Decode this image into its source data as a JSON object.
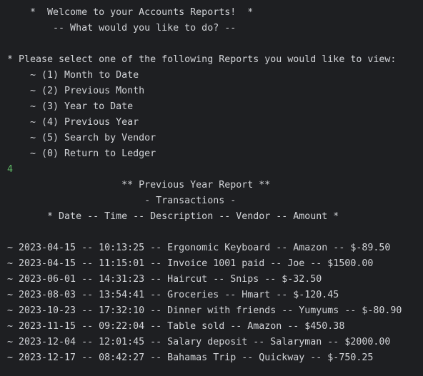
{
  "terminal": {
    "lines": [
      "    *  Welcome to your Accounts Reports!  *",
      "        -- What would you like to do? --",
      "",
      "* Please select one of the following Reports you would like to view:",
      "    ~ (1) Month to Date",
      "    ~ (2) Previous Month",
      "    ~ (3) Year to Date",
      "    ~ (4) Previous Year",
      "    ~ (5) Search by Vendor",
      "    ~ (0) Return to Ledger",
      "4",
      "                    ** Previous Year Report **",
      "                        - Transactions -",
      "       * Date -- Time -- Description -- Vendor -- Amount *",
      "",
      "~ 2023-04-15 -- 10:13:25 -- Ergonomic Keyboard -- Amazon -- $-89.50",
      "~ 2023-04-15 -- 11:15:01 -- Invoice 1001 paid -- Joe -- $1500.00",
      "~ 2023-06-01 -- 14:31:23 -- Haircut -- Snips -- $-32.50",
      "~ 2023-08-03 -- 13:54:41 -- Groceries -- Hmart -- $-120.45",
      "~ 2023-10-23 -- 17:32:10 -- Dinner with friends -- Yumyums -- $-80.90",
      "~ 2023-11-15 -- 09:22:04 -- Table sold -- Amazon -- $450.38",
      "~ 2023-12-04 -- 12:01:45 -- Salary deposit -- Salaryman -- $2000.00",
      "~ 2023-12-17 -- 08:42:27 -- Bahamas Trip -- Quickway -- $-750.25"
    ]
  },
  "colors": {
    "background": "#1e1f22",
    "text": "#d2d4d8",
    "user_input": "#5fb865"
  }
}
